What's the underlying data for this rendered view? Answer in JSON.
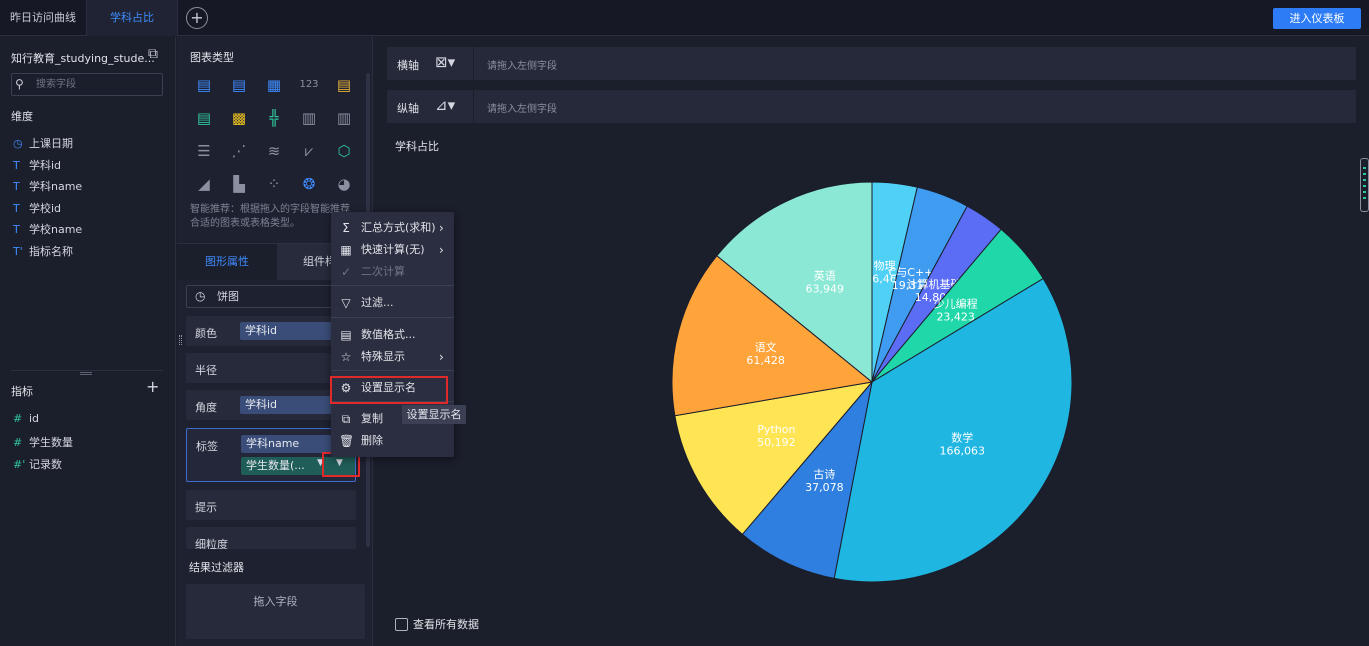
{
  "tabs": [
    {
      "label": "昨日访问曲线"
    },
    {
      "label": "学科占比"
    }
  ],
  "add_tab_symbol": "+",
  "enter_dashboard_label": "进入仪表板",
  "left_panel": {
    "dataset_title": "知行教育_studying_stude...",
    "search_placeholder": "搜索字段",
    "dimensions_label": "维度",
    "dimensions": [
      {
        "icon": "clock-icon",
        "glyph": "◷",
        "label": "上课日期"
      },
      {
        "icon": "text-type-icon",
        "glyph": "T",
        "label": "学科id"
      },
      {
        "icon": "text-type-icon",
        "glyph": "T",
        "label": "学科name"
      },
      {
        "icon": "text-type-icon",
        "glyph": "T",
        "label": "学校id"
      },
      {
        "icon": "text-type-icon",
        "glyph": "T",
        "label": "学校name"
      },
      {
        "icon": "text-type-icon",
        "glyph": "T'",
        "label": "指标名称"
      }
    ],
    "metrics_label": "指标",
    "metrics": [
      {
        "icon": "hash-icon",
        "glyph": "#",
        "label": "id"
      },
      {
        "icon": "hash-icon",
        "glyph": "#",
        "label": "学生数量"
      },
      {
        "icon": "hash-icon",
        "glyph": "#'",
        "label": "记录数"
      }
    ]
  },
  "mid_panel": {
    "chart_type_label": "图表类型",
    "smart_recommend": "智能推荐：根据拖入的字段智能推荐合适的图表或表格类型。",
    "subtab_graphic": "图形属性",
    "subtab_component": "组件样式",
    "chart_select": "饼图",
    "rows": {
      "color_label": "颜色",
      "color_field": "学科id",
      "radius_label": "半径",
      "angle_label": "角度",
      "angle_field": "学科id",
      "label_label": "标签",
      "label_field_1": "学科name",
      "label_field_2": "学生数量(...",
      "tip_label": "提示",
      "granularity_label": "细粒度"
    },
    "result_filter_label": "结果过滤器",
    "drop_field_label": "拖入字段"
  },
  "context_menu": {
    "items": [
      {
        "icon": "sigma-icon",
        "glyph": "Σ",
        "label": "汇总方式(求和)",
        "submenu": true,
        "disabled": false
      },
      {
        "icon": "quick-calc-icon",
        "glyph": "▦",
        "label": "快速计算(无)",
        "submenu": true,
        "disabled": false
      },
      {
        "icon": "check-icon",
        "glyph": "✓",
        "label": "二次计算",
        "submenu": false,
        "disabled": true
      },
      {
        "icon": "filter-icon",
        "glyph": "▽",
        "label": "过滤...",
        "submenu": false,
        "disabled": false
      },
      {
        "icon": "number-format-icon",
        "glyph": "▤",
        "label": "数值格式...",
        "submenu": false,
        "disabled": false
      },
      {
        "icon": "star-icon",
        "glyph": "☆",
        "label": "特殊显示",
        "submenu": true,
        "disabled": false
      },
      {
        "icon": "gear-icon",
        "glyph": "⚙",
        "label": "设置显示名",
        "submenu": false,
        "disabled": false
      },
      {
        "icon": "copy-icon",
        "glyph": "⧉",
        "label": "复制",
        "submenu": false,
        "disabled": false
      },
      {
        "icon": "trash-icon",
        "glyph": "🗑",
        "label": "删除",
        "submenu": false,
        "disabled": false
      }
    ],
    "tooltip": "设置显示名"
  },
  "axes": {
    "x_label": "横轴",
    "y_label": "纵轴",
    "placeholder": "请拖入左侧字段"
  },
  "chart_title": "学科占比",
  "view_all_label": "查看所有数据",
  "chart_data": {
    "type": "pie",
    "title": "学科占比",
    "slices": [
      {
        "name": "物理",
        "value": 16465,
        "color": "#4fd0f5"
      },
      {
        "name": "C与C++",
        "value": 19311,
        "color": "#3f9cf0"
      },
      {
        "name": "计算机基础",
        "value": 14804,
        "color": "#5b6cf5"
      },
      {
        "name": "少儿编程",
        "value": 23423,
        "color": "#1fd7a8"
      },
      {
        "name": "数学",
        "value": 166063,
        "color": "#1fb6e2"
      },
      {
        "name": "古诗",
        "value": 37078,
        "color": "#2f7fe0"
      },
      {
        "name": "Python",
        "value": 50192,
        "color": "#ffe454"
      },
      {
        "name": "语文",
        "value": 61428,
        "color": "#ffa43a"
      },
      {
        "name": "英语",
        "value": 63949,
        "color": "#8be8d4"
      }
    ],
    "display_labels": [
      "物理\n16,465",
      "C与C++\n19,311",
      "计算机基础\n14,804",
      "少儿编程\n23,423",
      "数学\n166,063",
      "古诗\n37,078",
      "Python\n50,192",
      "语文\n61,428",
      "英语\n63,949"
    ]
  }
}
